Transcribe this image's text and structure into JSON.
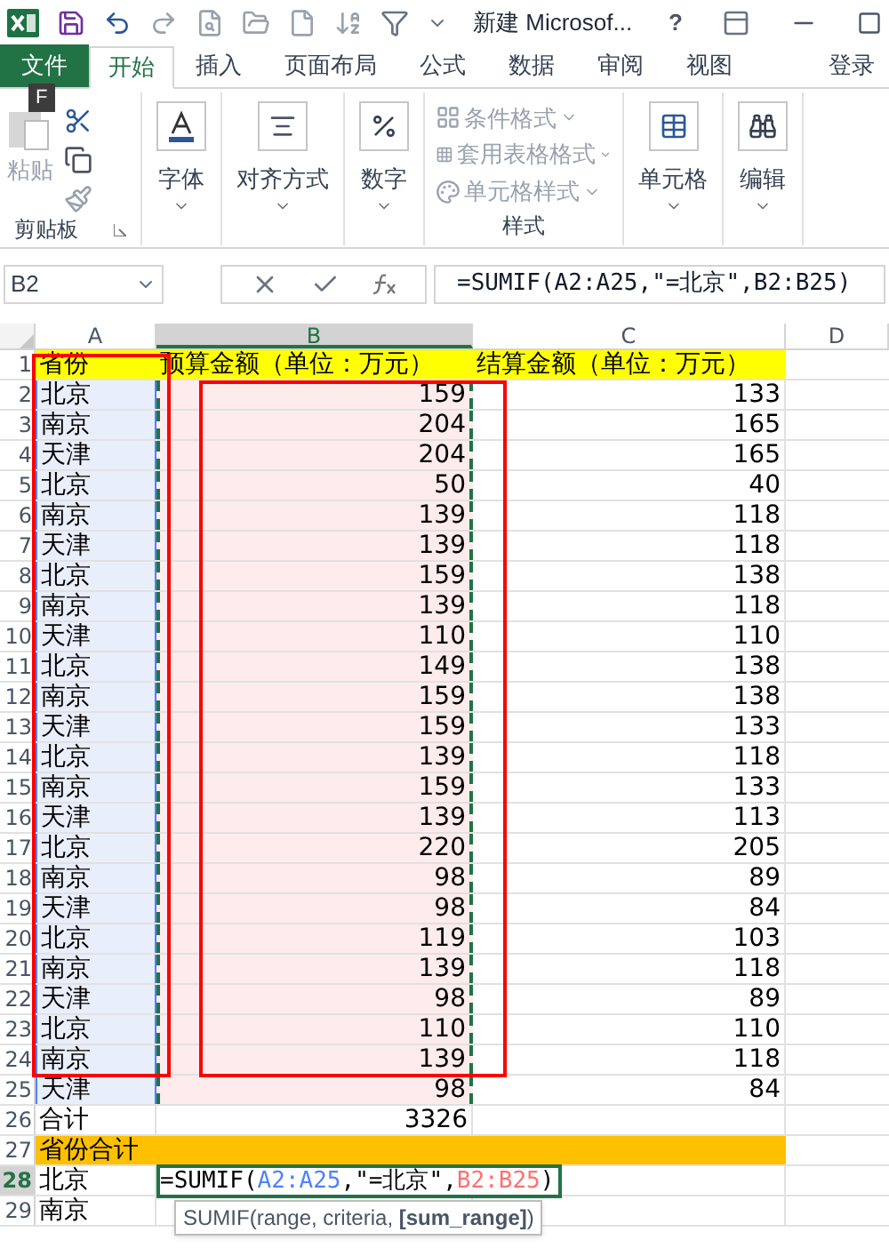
{
  "title_bar": {
    "title": "新建 Microsof...",
    "help": "?"
  },
  "tabs": [
    {
      "label": "文件",
      "kind": "file",
      "selected": false
    },
    {
      "label": "开始",
      "kind": "tab",
      "selected": true
    },
    {
      "label": "插入",
      "kind": "tab",
      "selected": false
    },
    {
      "label": "页面布局",
      "kind": "tab",
      "selected": false
    },
    {
      "label": "公式",
      "kind": "tab",
      "selected": false
    },
    {
      "label": "数据",
      "kind": "tab",
      "selected": false
    },
    {
      "label": "审阅",
      "kind": "tab",
      "selected": false
    },
    {
      "label": "视图",
      "kind": "tab",
      "selected": false
    }
  ],
  "sign_in": "登录",
  "key_tip": "F",
  "ribbon": {
    "clipboard": {
      "paste": "粘贴",
      "paste_disabled": true,
      "label": "剪贴板"
    },
    "groups": [
      {
        "kind": "font",
        "label": "字体"
      },
      {
        "kind": "align",
        "label": "对齐方式"
      },
      {
        "kind": "number",
        "label": "数字"
      }
    ],
    "styles": {
      "label": "样式",
      "items": [
        {
          "label": "条件格式",
          "disabled": true
        },
        {
          "label": "套用表格格式",
          "disabled": true
        },
        {
          "label": "单元格样式",
          "disabled": true
        }
      ]
    },
    "tail": [
      {
        "kind": "cells",
        "label": "单元格"
      },
      {
        "kind": "edit",
        "label": "编辑"
      }
    ]
  },
  "formula_bar": {
    "name_box": "B2",
    "formula": "=SUMIF(A2:A25,\"=北京\",B2:B25)"
  },
  "sheet": {
    "columns": [
      {
        "label": "A",
        "selected": false
      },
      {
        "label": "B",
        "selected": true
      },
      {
        "label": "C",
        "selected": false
      },
      {
        "label": "D",
        "selected": false
      }
    ],
    "highlight_refs": true,
    "rows": [
      {
        "header": "1",
        "kind": "title",
        "cells": [
          "省份",
          "预算金额（单位：万元）",
          "结算金额（单位：万元）"
        ]
      },
      {
        "header": "2",
        "kind": "data",
        "cells": [
          "北京",
          "159",
          "133"
        ]
      },
      {
        "header": "3",
        "kind": "data",
        "cells": [
          "南京",
          "204",
          "165"
        ]
      },
      {
        "header": "4",
        "kind": "data",
        "cells": [
          "天津",
          "204",
          "165"
        ]
      },
      {
        "header": "5",
        "kind": "data",
        "cells": [
          "北京",
          "50",
          "40"
        ]
      },
      {
        "header": "6",
        "kind": "data",
        "cells": [
          "南京",
          "139",
          "118"
        ]
      },
      {
        "header": "7",
        "kind": "data",
        "cells": [
          "天津",
          "139",
          "118"
        ]
      },
      {
        "header": "8",
        "kind": "data",
        "cells": [
          "北京",
          "159",
          "138"
        ]
      },
      {
        "header": "9",
        "kind": "data",
        "cells": [
          "南京",
          "139",
          "118"
        ]
      },
      {
        "header": "10",
        "kind": "data",
        "cells": [
          "天津",
          "110",
          "110"
        ]
      },
      {
        "header": "11",
        "kind": "data",
        "cells": [
          "北京",
          "149",
          "138"
        ]
      },
      {
        "header": "12",
        "kind": "data",
        "cells": [
          "南京",
          "159",
          "138"
        ]
      },
      {
        "header": "13",
        "kind": "data",
        "cells": [
          "天津",
          "159",
          "133"
        ]
      },
      {
        "header": "14",
        "kind": "data",
        "cells": [
          "北京",
          "139",
          "118"
        ]
      },
      {
        "header": "15",
        "kind": "data",
        "cells": [
          "南京",
          "159",
          "133"
        ]
      },
      {
        "header": "16",
        "kind": "data",
        "cells": [
          "天津",
          "139",
          "113"
        ]
      },
      {
        "header": "17",
        "kind": "data",
        "cells": [
          "北京",
          "220",
          "205"
        ]
      },
      {
        "header": "18",
        "kind": "data",
        "cells": [
          "南京",
          "98",
          "89"
        ]
      },
      {
        "header": "19",
        "kind": "data",
        "cells": [
          "天津",
          "98",
          "84"
        ]
      },
      {
        "header": "20",
        "kind": "data",
        "cells": [
          "北京",
          "119",
          "103"
        ]
      },
      {
        "header": "21",
        "kind": "data",
        "cells": [
          "南京",
          "139",
          "118"
        ]
      },
      {
        "header": "22",
        "kind": "data",
        "cells": [
          "天津",
          "98",
          "89"
        ]
      },
      {
        "header": "23",
        "kind": "data",
        "cells": [
          "北京",
          "110",
          "110"
        ]
      },
      {
        "header": "24",
        "kind": "data",
        "cells": [
          "南京",
          "139",
          "118"
        ]
      },
      {
        "header": "25",
        "kind": "data",
        "cells": [
          "天津",
          "98",
          "84"
        ]
      },
      {
        "header": "26",
        "kind": "total",
        "cells": [
          "合计",
          "3326"
        ]
      },
      {
        "header": "27",
        "kind": "section",
        "cells": [
          "省份合计"
        ]
      },
      {
        "header": "28",
        "kind": "edit",
        "active": true,
        "cells": [
          "北京"
        ],
        "formula": [
          {
            "text": "=SUMIF("
          },
          {
            "text": "A2:A25",
            "color": "#4f81ff"
          },
          {
            "text": ",\"=北京\","
          },
          {
            "text": "B2:B25",
            "color": "#ff7070"
          },
          {
            "text": ")"
          }
        ],
        "tooltip": "SUMIF(range, criteria, **[sum_range]**)"
      },
      {
        "header": "29",
        "kind": "plain",
        "cells": [
          "南京"
        ]
      }
    ]
  }
}
